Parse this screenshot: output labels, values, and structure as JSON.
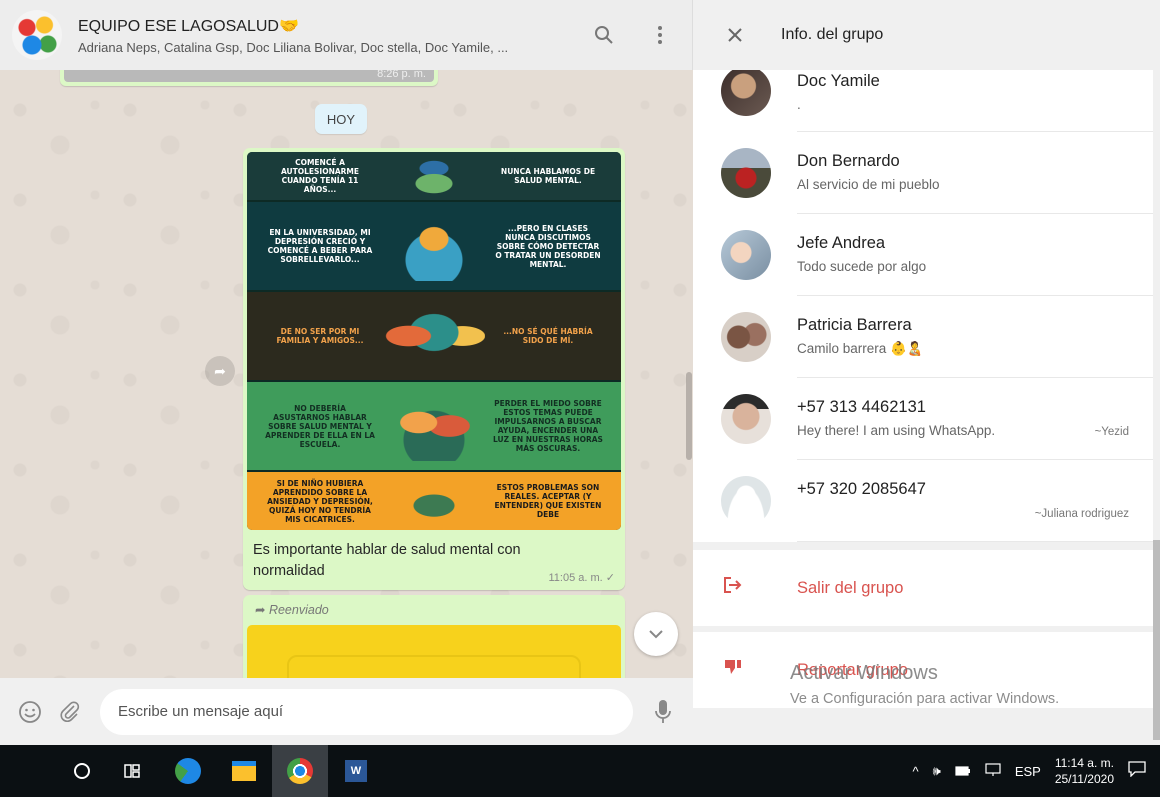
{
  "chat": {
    "group_name": "EQUIPO ESE LAGOSALUD🤝",
    "members_line": "Adriana Neps, Catalina Gsp, Doc Liliana Bolivar, Doc stella, Doc Yamile, ...",
    "search_icon": "search-icon",
    "menu_icon": "menu-icon",
    "prev_time": "8:26 p. m.",
    "day_label": "HOY",
    "comic_captions": {
      "p1_left": "COMENCÉ A AUTOLESIONARME CUANDO TENÍA 11 AÑOS...",
      "p1_right": "NUNCA HABLAMOS DE SALUD MENTAL.",
      "p2_left": "EN LA UNIVERSIDAD, MI DEPRESIÓN CRECIÓ Y COMENCÉ A BEBER PARA SOBRELLEVARLO...",
      "p2_right": "...PERO EN CLASES NUNCA DISCUTIMOS SOBRE CÓMO DETECTAR O TRATAR UN DESORDEN MENTAL.",
      "p3_left": "DE NO SER POR MI FAMILIA Y AMIGOS...",
      "p3_right": "...NO SÉ QUÉ HABRÍA SIDO DE MÍ.",
      "p4_left": "NO DEBERÍA ASUSTARNOS HABLAR SOBRE SALUD MENTAL Y APRENDER DE ELLA EN LA ESCUELA.",
      "p4_right": "PERDER EL MIEDO SOBRE ESTOS TEMAS PUEDE IMPULSARNOS A BUSCAR AYUDA, ENCENDER UNA LUZ EN NUESTRAS HORAS MÁS OSCURAS.",
      "p5_left": "SI DE NIÑO HUBIERA APRENDIDO SOBRE LA ANSIEDAD Y DEPRESIÓN, QUIZÁ HOY NO TENDRÍA MIS CICATRICES.",
      "p5_right": "ESTOS PROBLEMAS SON REALES. ACEPTAR (Y ENTENDER) QUE EXISTEN DEBE"
    },
    "message_text": "Es importante hablar de salud mental con normalidad",
    "message_time": "11:05 a. m. ✓",
    "forwarded_label": "Reenviado",
    "composer_placeholder": "Escribe un mensaje aquí"
  },
  "info": {
    "title": "Info. del grupo",
    "members": [
      {
        "name": "Doc Yamile",
        "status": ".",
        "alias": ""
      },
      {
        "name": "Don Bernardo",
        "status": "Al servicio de mi pueblo",
        "alias": ""
      },
      {
        "name": "Jefe Andrea",
        "status": "Todo sucede por algo",
        "alias": ""
      },
      {
        "name": "Patricia Barrera",
        "status": "Camilo barrera 👶🧑‍🍼",
        "alias": ""
      },
      {
        "name": "+57 313 4462131",
        "status": "Hey there! I am using WhatsApp.",
        "alias": "~Yezid"
      },
      {
        "name": "+57 320 2085647",
        "status": "",
        "alias": "~Juliana rodriguez"
      }
    ],
    "exit_label": "Salir del grupo",
    "report_label": "Reportar grupo"
  },
  "watermark": {
    "line1": "Activar Windows",
    "line2": "Ve a Configuración para activar Windows."
  },
  "taskbar": {
    "lang": "ESP",
    "time": "11:14 a. m.",
    "date": "25/11/2020"
  }
}
